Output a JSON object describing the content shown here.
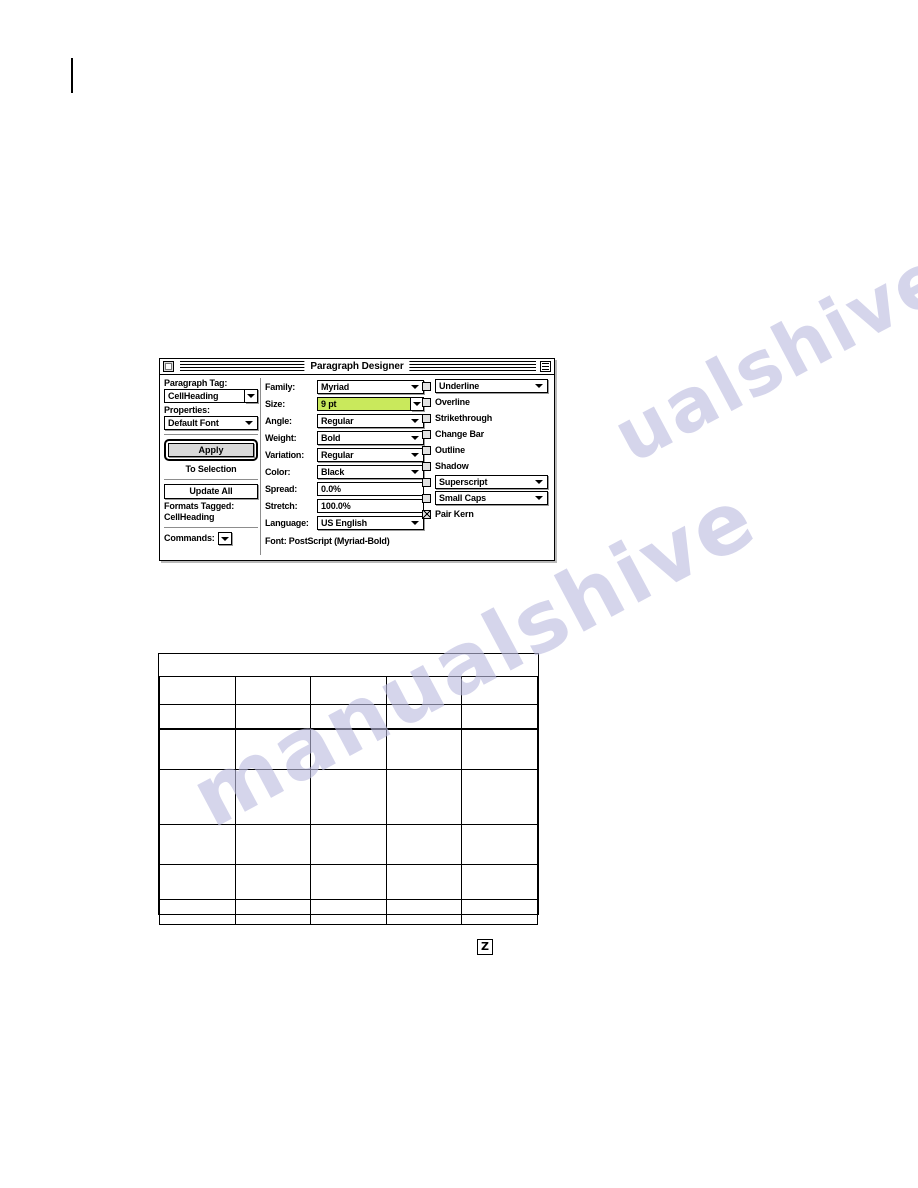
{
  "page": {
    "margin_rule": "",
    "watermark_line_1": "manualshive",
    "watermark_line_2": "ualshive.com",
    "footer_glyph": "Z"
  },
  "dialog": {
    "title": "Paragraph Designer",
    "close_box": "close-box",
    "zoom_box": "zoom-box",
    "left_pane": {
      "paragraph_tag_label": "Paragraph Tag:",
      "paragraph_tag_value": "CellHeading",
      "properties_label": "Properties:",
      "properties_value": "Default Font",
      "apply_button": "Apply",
      "apply_caption": "To Selection",
      "update_all_button": "Update All",
      "formats_tagged_label": "Formats Tagged:",
      "formats_tagged_value": "CellHeading",
      "commands_label": "Commands:"
    },
    "properties": [
      {
        "label": "Family:",
        "value": "Myriad",
        "control": "popup",
        "highlight": false
      },
      {
        "label": "Size:",
        "value": "9 pt",
        "control": "combo",
        "highlight": true
      },
      {
        "label": "Angle:",
        "value": "Regular",
        "control": "popup",
        "highlight": false
      },
      {
        "label": "Weight:",
        "value": "Bold",
        "control": "popup",
        "highlight": false
      },
      {
        "label": "Variation:",
        "value": "Regular",
        "control": "popup",
        "highlight": false
      },
      {
        "label": "Color:",
        "value": "Black",
        "control": "popup",
        "highlight": false
      },
      {
        "label": "Spread:",
        "value": "0.0%",
        "control": "text",
        "highlight": false
      },
      {
        "label": "Stretch:",
        "value": "100.0%",
        "control": "text",
        "highlight": false
      },
      {
        "label": "Language:",
        "value": "US English",
        "control": "popup",
        "highlight": false
      }
    ],
    "font_status": "Font: PostScript (Myriad-Bold)",
    "options": [
      {
        "label": "Underline",
        "checked": false,
        "control": "popup"
      },
      {
        "label": "Overline",
        "checked": false,
        "control": "checkbox"
      },
      {
        "label": "Strikethrough",
        "checked": false,
        "control": "checkbox"
      },
      {
        "label": "Change Bar",
        "checked": false,
        "control": "checkbox"
      },
      {
        "label": "Outline",
        "checked": false,
        "control": "checkbox"
      },
      {
        "label": "Shadow",
        "checked": false,
        "control": "checkbox"
      },
      {
        "label": "Superscript",
        "checked": false,
        "control": "popup"
      },
      {
        "label": "Small Caps",
        "checked": false,
        "control": "popup"
      },
      {
        "label": "Pair Kern",
        "checked": true,
        "control": "checkbox"
      }
    ],
    "colors": {
      "highlight": "#c9e95c",
      "button_face": "#d9d9d9",
      "checkbox_face": "#e2e2e2",
      "border": "#000000",
      "shadow": "#9a9a9a"
    }
  },
  "table": {
    "rows": [
      {
        "type": "title",
        "cells": [
          ""
        ]
      },
      {
        "type": "header",
        "cells": [
          "",
          "",
          "",
          "",
          ""
        ]
      },
      {
        "type": "body",
        "cells": [
          "",
          "",
          "",
          "",
          ""
        ],
        "heavy_bottom": true
      },
      {
        "type": "body",
        "cells": [
          "",
          "",
          "",
          "",
          ""
        ]
      },
      {
        "type": "body",
        "cells": [
          "",
          "",
          "",
          "",
          ""
        ]
      },
      {
        "type": "body",
        "cells": [
          "",
          "",
          "",
          "",
          ""
        ]
      },
      {
        "type": "body",
        "cells": [
          "",
          "",
          "",
          "",
          ""
        ]
      },
      {
        "type": "body",
        "cells": [
          "",
          "",
          "",
          "",
          ""
        ]
      }
    ]
  }
}
